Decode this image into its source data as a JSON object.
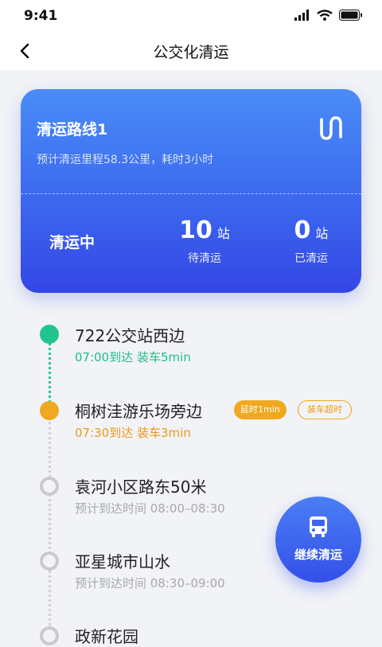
{
  "status_bar": {
    "time": "9:41"
  },
  "header": {
    "title": "公交化清运"
  },
  "route": {
    "title": "清运路线1",
    "subtitle": "预计清运里程58.3公里，耗时3小时",
    "status": "清运中",
    "pending": {
      "count": "10",
      "unit": "站",
      "label": "待清运"
    },
    "done": {
      "count": "0",
      "unit": "站",
      "label": "已清运"
    }
  },
  "stops": [
    {
      "name": "722公交站西边",
      "detail": "07:00到达 装车5min",
      "state": "done"
    },
    {
      "name": "桐树洼游乐场旁边",
      "detail": "07:30到达 装车3min",
      "state": "warning",
      "badges": [
        "延时1min",
        "装车超时"
      ]
    },
    {
      "name": "袁河小区路东50米",
      "detail": "预计到达时间   08:00–08:30",
      "state": "pending"
    },
    {
      "name": "亚星城市山水",
      "detail": "预计到达时间   08:30–09:00",
      "state": "pending"
    },
    {
      "name": "政新花园",
      "detail": "",
      "state": "pending"
    }
  ],
  "fab": {
    "label": "继续清运"
  },
  "colors": {
    "accent_blue": "#3e6ff0",
    "green": "#1fc58d",
    "orange": "#f0a81e",
    "gray": "#c9c9cf"
  }
}
